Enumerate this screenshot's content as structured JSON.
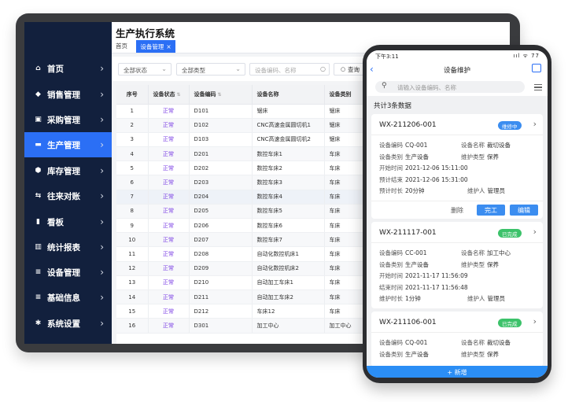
{
  "desktop": {
    "sidebar": {
      "items": [
        {
          "label": "首页",
          "icon": "home-icon",
          "active": false
        },
        {
          "label": "销售管理",
          "icon": "tag-icon",
          "active": false
        },
        {
          "label": "采购管理",
          "icon": "shopping-bag-icon",
          "active": false
        },
        {
          "label": "生产管理",
          "icon": "monitor-icon",
          "active": true
        },
        {
          "label": "库存管理",
          "icon": "box-icon",
          "active": false
        },
        {
          "label": "往来对账",
          "icon": "transfer-icon",
          "active": false
        },
        {
          "label": "看板",
          "icon": "bar-chart-icon",
          "active": false
        },
        {
          "label": "统计报表",
          "icon": "stats-icon",
          "active": false
        },
        {
          "label": "设备管理",
          "icon": "sliders-icon",
          "active": false
        },
        {
          "label": "基础信息",
          "icon": "sliders-icon",
          "active": false
        },
        {
          "label": "系统设置",
          "icon": "gear-icon",
          "active": false
        }
      ]
    },
    "header": {
      "title": "生产执行系统"
    },
    "tabs": {
      "home": "首页",
      "active": "设备管理",
      "close": "×"
    },
    "filters": {
      "status": "全部状态",
      "type": "全部类型",
      "search_placeholder": "设备编码、名称",
      "query_button": "查询"
    },
    "table": {
      "columns": [
        "序号",
        "设备状态",
        "设备编码",
        "设备名称",
        "设备类别"
      ],
      "rows": [
        [
          "1",
          "正常",
          "D101",
          "锯床",
          "锯床"
        ],
        [
          "2",
          "正常",
          "D102",
          "CNC高速金属圆切机1",
          "锯床"
        ],
        [
          "3",
          "正常",
          "D103",
          "CNC高速金属圆切机2",
          "锯床"
        ],
        [
          "4",
          "正常",
          "D201",
          "数控车床1",
          "车床"
        ],
        [
          "5",
          "正常",
          "D202",
          "数控车床2",
          "车床"
        ],
        [
          "6",
          "正常",
          "D203",
          "数控车床3",
          "车床"
        ],
        [
          "7",
          "正常",
          "D204",
          "数控车床4",
          "车床"
        ],
        [
          "8",
          "正常",
          "D205",
          "数控车床5",
          "车床"
        ],
        [
          "9",
          "正常",
          "D206",
          "数控车床6",
          "车床"
        ],
        [
          "10",
          "正常",
          "D207",
          "数控车床7",
          "车床"
        ],
        [
          "11",
          "正常",
          "D208",
          "自动化数控机床1",
          "车床"
        ],
        [
          "12",
          "正常",
          "D209",
          "自动化数控机床2",
          "车床"
        ],
        [
          "13",
          "正常",
          "D210",
          "自动加工车床1",
          "车床"
        ],
        [
          "14",
          "正常",
          "D211",
          "自动加工车床2",
          "车床"
        ],
        [
          "15",
          "正常",
          "D212",
          "车床12",
          "车床"
        ],
        [
          "16",
          "正常",
          "D301",
          "加工中心",
          "加工中心"
        ]
      ]
    }
  },
  "mobile": {
    "status_bar": {
      "time": "下午3:11",
      "right": "ııl ᯤ 77"
    },
    "nav": {
      "title": "设备维护"
    },
    "search_placeholder": "请输入设备编码、名称",
    "count_text": "共计3条数据",
    "cards": [
      {
        "id": "WX-211206-001",
        "badge": "维修中",
        "badge_color": "#3b8df0",
        "fields": [
          {
            "k": "设备编码",
            "v": "CQ-001"
          },
          {
            "k": "设备名称",
            "v": "裁切设备"
          },
          {
            "k": "设备类别",
            "v": "生产设备"
          },
          {
            "k": "维护类型",
            "v": "保养"
          },
          {
            "k": "开始时间",
            "v": "2021-12-06 15:11:00"
          },
          {
            "k": "预计结束",
            "v": "2021-12-06 15:31:00"
          },
          {
            "k": "预计时长",
            "v": "20分钟"
          },
          {
            "k": "维护人",
            "v": "管理员"
          }
        ],
        "actions": [
          "删除",
          "完工",
          "编辑"
        ]
      },
      {
        "id": "WX-211117-001",
        "badge": "已完成",
        "badge_color": "#3cc26a",
        "fields": [
          {
            "k": "设备编码",
            "v": "CC-001"
          },
          {
            "k": "设备名称",
            "v": "加工中心"
          },
          {
            "k": "设备类别",
            "v": "生产设备"
          },
          {
            "k": "维护类型",
            "v": "保养"
          },
          {
            "k": "开始时间",
            "v": "2021-11-17 11:56:09"
          },
          {
            "k": "结束时间",
            "v": "2021-11-17 11:56:48"
          },
          {
            "k": "维护时长",
            "v": "1分钟"
          },
          {
            "k": "维护人",
            "v": "管理员"
          }
        ]
      },
      {
        "id": "WX-211106-001",
        "badge": "已完成",
        "badge_color": "#3cc26a",
        "fields": [
          {
            "k": "设备编码",
            "v": "CQ-001"
          },
          {
            "k": "设备名称",
            "v": "裁切设备"
          },
          {
            "k": "设备类别",
            "v": "生产设备"
          },
          {
            "k": "维护类型",
            "v": "保养"
          }
        ]
      }
    ],
    "add_button": "+ 新增"
  },
  "colors": {
    "accent": "#2b6ff5",
    "sidebar": "#12203d",
    "status_normal": "#7b3fe4"
  }
}
